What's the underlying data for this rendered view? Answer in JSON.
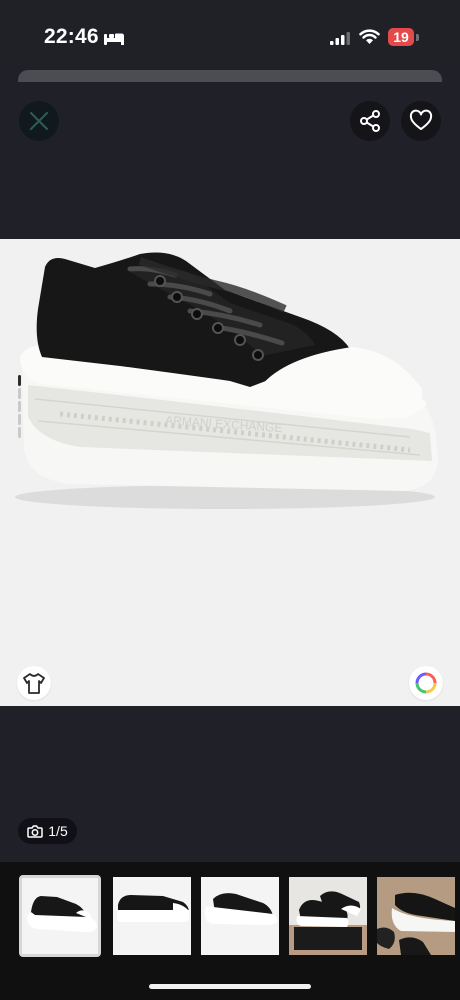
{
  "status_bar": {
    "time": "22:46",
    "battery": "19",
    "icons": [
      "bed-icon",
      "cellular-signal-icon",
      "wifi-icon",
      "battery-icon"
    ]
  },
  "actions": {
    "close_icon": "close-icon",
    "share_icon": "share-icon",
    "favorite_icon": "heart-icon"
  },
  "product_image": {
    "brand_text": "ARMANI EXCHANGE",
    "page_indicator": {
      "current": 1,
      "total": 5
    }
  },
  "gallery": {
    "counter": "1/5",
    "counter_icon": "camera-icon",
    "thumbnails": [
      "sneaker-front-angle",
      "sneaker-side",
      "sneaker-back-angle",
      "sneaker-pair-on-box",
      "sneakers-being-held"
    ]
  },
  "tools": {
    "shirt_icon": "shirt-icon",
    "color_icon": "color-wheel-icon"
  }
}
